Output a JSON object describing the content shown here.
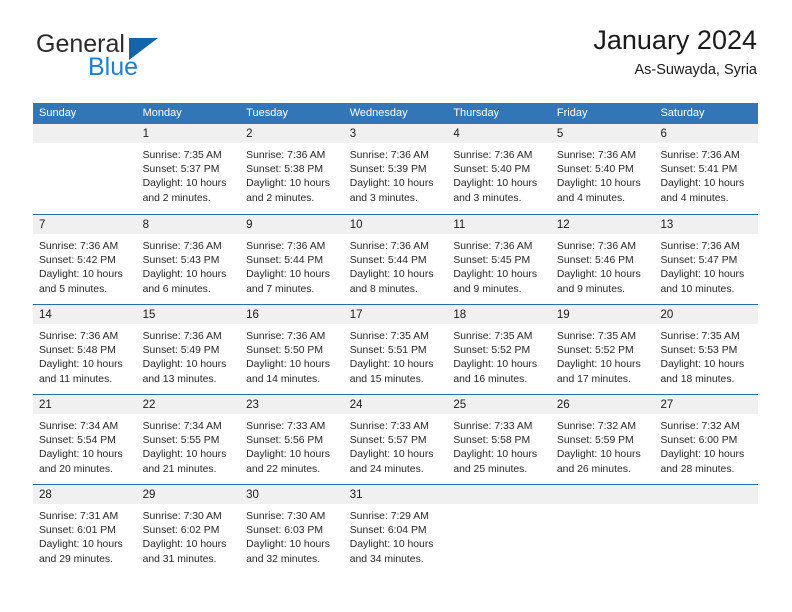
{
  "brand": {
    "name_part1": "General",
    "name_part2": "Blue",
    "logo_icon": "triangle-logo-icon"
  },
  "header": {
    "title": "January 2024",
    "subtitle": "As-Suwayda, Syria"
  },
  "weekdays": [
    "Sunday",
    "Monday",
    "Tuesday",
    "Wednesday",
    "Thursday",
    "Friday",
    "Saturday"
  ],
  "colors": {
    "header_blue": "#3276b8",
    "row_divider_blue": "#2a6dae",
    "date_band_gray": "#f0f0f0",
    "brand_blue": "#1d7fd4",
    "logo_triangle": "#1464ab"
  },
  "weeks": [
    [
      {
        "day": "",
        "lines": []
      },
      {
        "day": "1",
        "lines": [
          "Sunrise: 7:35 AM",
          "Sunset: 5:37 PM",
          "Daylight: 10 hours",
          "and 2 minutes."
        ]
      },
      {
        "day": "2",
        "lines": [
          "Sunrise: 7:36 AM",
          "Sunset: 5:38 PM",
          "Daylight: 10 hours",
          "and 2 minutes."
        ]
      },
      {
        "day": "3",
        "lines": [
          "Sunrise: 7:36 AM",
          "Sunset: 5:39 PM",
          "Daylight: 10 hours",
          "and 3 minutes."
        ]
      },
      {
        "day": "4",
        "lines": [
          "Sunrise: 7:36 AM",
          "Sunset: 5:40 PM",
          "Daylight: 10 hours",
          "and 3 minutes."
        ]
      },
      {
        "day": "5",
        "lines": [
          "Sunrise: 7:36 AM",
          "Sunset: 5:40 PM",
          "Daylight: 10 hours",
          "and 4 minutes."
        ]
      },
      {
        "day": "6",
        "lines": [
          "Sunrise: 7:36 AM",
          "Sunset: 5:41 PM",
          "Daylight: 10 hours",
          "and 4 minutes."
        ]
      }
    ],
    [
      {
        "day": "7",
        "lines": [
          "Sunrise: 7:36 AM",
          "Sunset: 5:42 PM",
          "Daylight: 10 hours",
          "and 5 minutes."
        ]
      },
      {
        "day": "8",
        "lines": [
          "Sunrise: 7:36 AM",
          "Sunset: 5:43 PM",
          "Daylight: 10 hours",
          "and 6 minutes."
        ]
      },
      {
        "day": "9",
        "lines": [
          "Sunrise: 7:36 AM",
          "Sunset: 5:44 PM",
          "Daylight: 10 hours",
          "and 7 minutes."
        ]
      },
      {
        "day": "10",
        "lines": [
          "Sunrise: 7:36 AM",
          "Sunset: 5:44 PM",
          "Daylight: 10 hours",
          "and 8 minutes."
        ]
      },
      {
        "day": "11",
        "lines": [
          "Sunrise: 7:36 AM",
          "Sunset: 5:45 PM",
          "Daylight: 10 hours",
          "and 9 minutes."
        ]
      },
      {
        "day": "12",
        "lines": [
          "Sunrise: 7:36 AM",
          "Sunset: 5:46 PM",
          "Daylight: 10 hours",
          "and 9 minutes."
        ]
      },
      {
        "day": "13",
        "lines": [
          "Sunrise: 7:36 AM",
          "Sunset: 5:47 PM",
          "Daylight: 10 hours",
          "and 10 minutes."
        ]
      }
    ],
    [
      {
        "day": "14",
        "lines": [
          "Sunrise: 7:36 AM",
          "Sunset: 5:48 PM",
          "Daylight: 10 hours",
          "and 11 minutes."
        ]
      },
      {
        "day": "15",
        "lines": [
          "Sunrise: 7:36 AM",
          "Sunset: 5:49 PM",
          "Daylight: 10 hours",
          "and 13 minutes."
        ]
      },
      {
        "day": "16",
        "lines": [
          "Sunrise: 7:36 AM",
          "Sunset: 5:50 PM",
          "Daylight: 10 hours",
          "and 14 minutes."
        ]
      },
      {
        "day": "17",
        "lines": [
          "Sunrise: 7:35 AM",
          "Sunset: 5:51 PM",
          "Daylight: 10 hours",
          "and 15 minutes."
        ]
      },
      {
        "day": "18",
        "lines": [
          "Sunrise: 7:35 AM",
          "Sunset: 5:52 PM",
          "Daylight: 10 hours",
          "and 16 minutes."
        ]
      },
      {
        "day": "19",
        "lines": [
          "Sunrise: 7:35 AM",
          "Sunset: 5:52 PM",
          "Daylight: 10 hours",
          "and 17 minutes."
        ]
      },
      {
        "day": "20",
        "lines": [
          "Sunrise: 7:35 AM",
          "Sunset: 5:53 PM",
          "Daylight: 10 hours",
          "and 18 minutes."
        ]
      }
    ],
    [
      {
        "day": "21",
        "lines": [
          "Sunrise: 7:34 AM",
          "Sunset: 5:54 PM",
          "Daylight: 10 hours",
          "and 20 minutes."
        ]
      },
      {
        "day": "22",
        "lines": [
          "Sunrise: 7:34 AM",
          "Sunset: 5:55 PM",
          "Daylight: 10 hours",
          "and 21 minutes."
        ]
      },
      {
        "day": "23",
        "lines": [
          "Sunrise: 7:33 AM",
          "Sunset: 5:56 PM",
          "Daylight: 10 hours",
          "and 22 minutes."
        ]
      },
      {
        "day": "24",
        "lines": [
          "Sunrise: 7:33 AM",
          "Sunset: 5:57 PM",
          "Daylight: 10 hours",
          "and 24 minutes."
        ]
      },
      {
        "day": "25",
        "lines": [
          "Sunrise: 7:33 AM",
          "Sunset: 5:58 PM",
          "Daylight: 10 hours",
          "and 25 minutes."
        ]
      },
      {
        "day": "26",
        "lines": [
          "Sunrise: 7:32 AM",
          "Sunset: 5:59 PM",
          "Daylight: 10 hours",
          "and 26 minutes."
        ]
      },
      {
        "day": "27",
        "lines": [
          "Sunrise: 7:32 AM",
          "Sunset: 6:00 PM",
          "Daylight: 10 hours",
          "and 28 minutes."
        ]
      }
    ],
    [
      {
        "day": "28",
        "lines": [
          "Sunrise: 7:31 AM",
          "Sunset: 6:01 PM",
          "Daylight: 10 hours",
          "and 29 minutes."
        ]
      },
      {
        "day": "29",
        "lines": [
          "Sunrise: 7:30 AM",
          "Sunset: 6:02 PM",
          "Daylight: 10 hours",
          "and 31 minutes."
        ]
      },
      {
        "day": "30",
        "lines": [
          "Sunrise: 7:30 AM",
          "Sunset: 6:03 PM",
          "Daylight: 10 hours",
          "and 32 minutes."
        ]
      },
      {
        "day": "31",
        "lines": [
          "Sunrise: 7:29 AM",
          "Sunset: 6:04 PM",
          "Daylight: 10 hours",
          "and 34 minutes."
        ]
      },
      {
        "day": "",
        "lines": []
      },
      {
        "day": "",
        "lines": []
      },
      {
        "day": "",
        "lines": []
      }
    ]
  ]
}
